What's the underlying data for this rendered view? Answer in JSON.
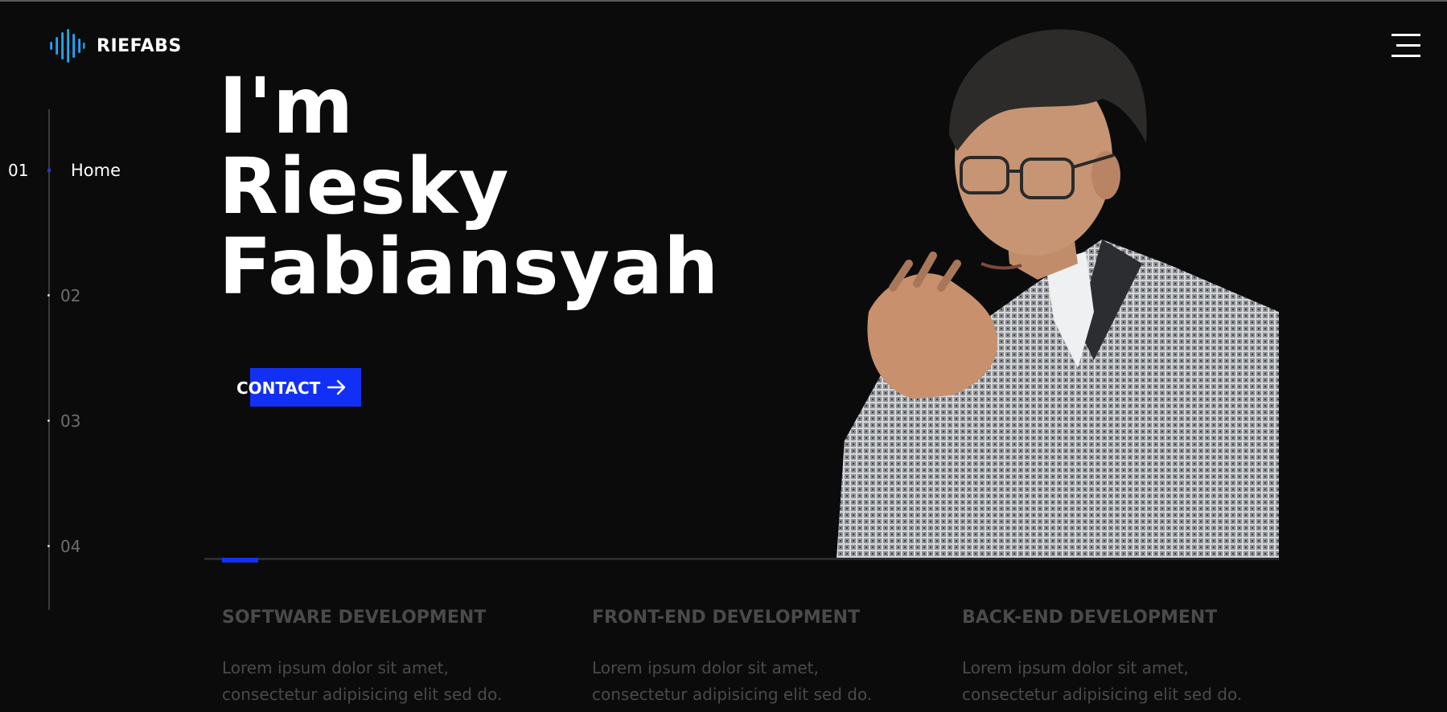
{
  "brand": {
    "name": "RIEFABS",
    "icon": "soundwave-logo-icon",
    "gradient": [
      "#1e6bff",
      "#17d1d6"
    ]
  },
  "menu": {
    "icon": "hamburger-menu-icon"
  },
  "nav": {
    "active": {
      "number": "01",
      "label": "Home"
    },
    "items": [
      {
        "number": "02"
      },
      {
        "number": "03"
      },
      {
        "number": "04"
      }
    ]
  },
  "hero": {
    "line1": "I'm",
    "line2": "Riesky",
    "line3": "Fabiansyah",
    "cta_label": "CONTACT",
    "cta_icon": "arrow-right-icon",
    "portrait_icon": "portrait-photo"
  },
  "progress": {
    "value": 0.034
  },
  "services": [
    {
      "title": "SOFTWARE DEVELOPMENT",
      "desc_line1": "Lorem ipsum dolor sit amet,",
      "desc_line2": "consectetur adipisicing elit sed do."
    },
    {
      "title": "FRONT-END DEVELOPMENT",
      "desc_line1": "Lorem ipsum dolor sit amet,",
      "desc_line2": "consectetur adipisicing elit sed do."
    },
    {
      "title": "BACK-END DEVELOPMENT",
      "desc_line1": "Lorem ipsum dolor sit amet,",
      "desc_line2": "consectetur adipisicing elit sed do."
    }
  ],
  "colors": {
    "accent": "#1230f5",
    "background": "#0b0b0c",
    "muted": "#4a4a4a"
  }
}
